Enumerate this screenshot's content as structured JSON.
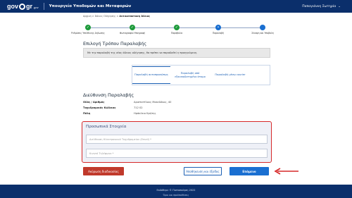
{
  "header": {
    "logo_text": "gov",
    "logo_suffix": "gr",
    "logo_sup": ".gov",
    "ministry": "Υπουργείο Υποδομών και Μεταφορών",
    "user_name": "Παπαγιάννη Σωτηρία",
    "user_caret": "⌄"
  },
  "breadcrumb": {
    "part1": "Αρχική",
    "sep": " > ",
    "part2": "Άδειες Οδήγησης",
    "part3": "Αντικατάσταση Άδειας"
  },
  "stepper": {
    "steps": [
      {
        "label": "Ρυθμίσεις Υπεύθυνης Δήλωσης",
        "state": "done",
        "glyph": "✓"
      },
      {
        "label": "Φωτογραφία Υπογραφή",
        "state": "done",
        "glyph": "✓"
      },
      {
        "label": "Παράβολα",
        "state": "done",
        "glyph": "✓"
      },
      {
        "label": "Παραλαβή",
        "state": "current",
        "glyph": "•"
      },
      {
        "label": "Σύνοψη και Υποβολή",
        "state": "todo",
        "glyph": ""
      }
    ]
  },
  "delivery": {
    "title": "Επιλογή Τρόπου Παραλαβής",
    "info": "Με την παραλαβή της νέας άδειας οδήγησης, θα πρέπει να παραδοθεί η προηγούμενη.",
    "options": [
      {
        "label": "Παραλαβή αυτοπροσώπως",
        "selected": true
      },
      {
        "label": "Παραλαβή από εξουσιοδοτημένο άτομο",
        "selected": false
      },
      {
        "label": "Παραλαβή μέσω courier",
        "selected": false
      }
    ]
  },
  "address": {
    "title": "Διεύθυνση Παραλαβής",
    "rows": [
      {
        "key": "Οδός / Αριθμός",
        "value": "Αριστοτέλους Μακεδόνος, 40"
      },
      {
        "key": "Ταχυδρομικός Κώδικας",
        "value": "712 02"
      },
      {
        "key": "Πόλη",
        "value": "Ηράκλειο Κρήτης"
      }
    ]
  },
  "personal": {
    "title": "Προσωπικά Στοιχεία",
    "email_placeholder": "Διεύθυνση Ηλεκτρονικού Ταχυδρομείου (Email) *",
    "phone_placeholder": "Κινητό Τηλέφωνο *"
  },
  "actions": {
    "cancel": "Ακύρωση διαδικασίας",
    "save": "Αποθήκευση και έξοδος",
    "next": "Επόμενο"
  },
  "footer": {
    "line1": "Εκδόθηκε © Πιστοποίηση 2022",
    "line2": "Όροι και προϋποθέσεις"
  },
  "colors": {
    "brand": "#0b2f6b",
    "primary": "#1a6fd1",
    "danger": "#c0392b",
    "success": "#1d9a3a",
    "highlight": "#d62828"
  }
}
